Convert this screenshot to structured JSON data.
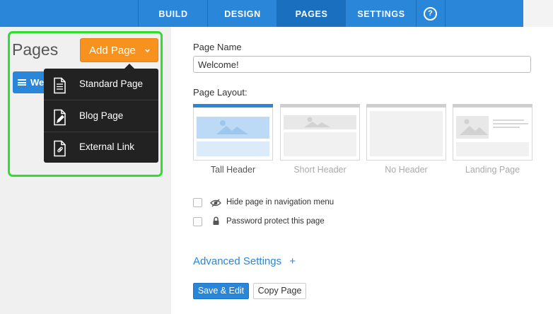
{
  "nav": {
    "tabs": [
      {
        "label": "BUILD",
        "active": false
      },
      {
        "label": "DESIGN",
        "active": false
      },
      {
        "label": "PAGES",
        "active": true
      },
      {
        "label": "SETTINGS",
        "active": false
      }
    ],
    "help": "?"
  },
  "sidebar": {
    "title": "Pages",
    "add_button": "Add Page",
    "current_page": "We",
    "menu": [
      {
        "label": "Standard Page",
        "icon": "document-lines-icon"
      },
      {
        "label": "Blog Page",
        "icon": "document-pencil-icon"
      },
      {
        "label": "External Link",
        "icon": "document-link-icon"
      }
    ]
  },
  "form": {
    "name_label": "Page Name",
    "name_value": "Welcome!",
    "layout_label": "Page Layout:",
    "layouts": [
      {
        "label": "Tall Header",
        "selected": true
      },
      {
        "label": "Short Header",
        "selected": false
      },
      {
        "label": "No Header",
        "selected": false
      },
      {
        "label": "Landing Page",
        "selected": false
      }
    ],
    "options": [
      {
        "label": "Hide page in navigation menu",
        "icon": "eye-slash-icon",
        "checked": false
      },
      {
        "label": "Password protect this page",
        "icon": "lock-icon",
        "checked": false
      }
    ],
    "advanced": "Advanced Settings",
    "advanced_icon": "+",
    "save_button": "Save & Edit",
    "copy_button": "Copy Page"
  },
  "colors": {
    "nav_blue": "#2a86d9",
    "nav_active": "#1b6fbf",
    "add_orange": "#f7921e",
    "highlight_green": "#2de02d",
    "menu_dark": "#222222"
  }
}
